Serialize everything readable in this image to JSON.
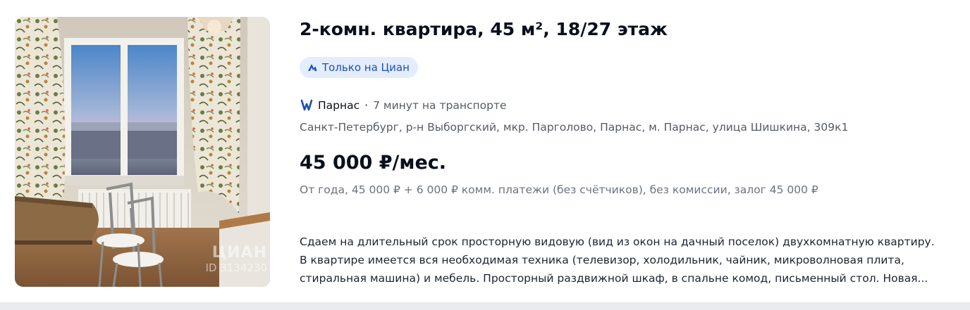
{
  "listing": {
    "title": "2-комн. квартира, 45 м², 18/27 этаж",
    "badge_label": "Только на Циан",
    "metro": {
      "station": "Парнас",
      "separator": "·",
      "time": "7 минут на транспорте",
      "icon": "metro-icon",
      "color": "#1f4fb8"
    },
    "address": "Санкт-Петербург, р-н Выборгский, мкр. Парголово, Парнас, м. Парнас, улица Шишкина, 309к1",
    "price": "45 000 ₽/мес.",
    "terms": "От года, 45 000 ₽ + 6 000 ₽ комм. платежи (без счётчиков), без комиссии, залог 45 000 ₽",
    "description_lines": [
      "Сдаем на длительный срок просторную видовую (вид из окон на дачный поселок) двухкомнатную квартиру.",
      "В квартире имеется вся необходимая техника (телевизор, холодильник, чайник, микроволновая плита,",
      "стиральная машина) и мебель. Просторный раздвижной шкаф, в спальне комод, письменный стол. Новая..."
    ],
    "photo": {
      "watermark": "ЦИАН",
      "id_text": "ID 3134230"
    }
  },
  "colors": {
    "badge_bg": "#e3edfe",
    "badge_text": "#1f4fb8",
    "text_primary": "#0a0f1c",
    "text_secondary": "#555b66"
  }
}
